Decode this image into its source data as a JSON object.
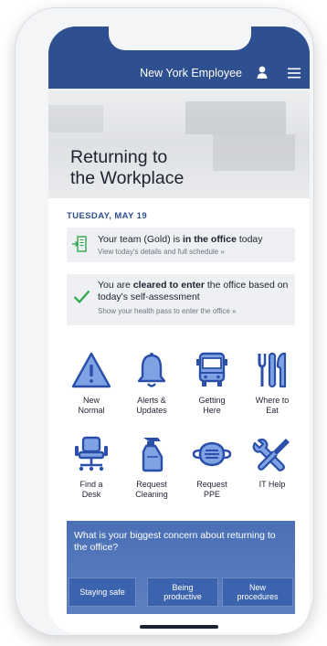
{
  "header": {
    "title": "New York Employee",
    "user_icon": "user-icon",
    "menu_icon": "menu-icon"
  },
  "hero": {
    "heading_line1": "Returning to",
    "heading_line2": "the Workplace"
  },
  "date": "TUESDAY, MAY 19",
  "cards": {
    "team": {
      "icon": "arrow-into-building-icon",
      "pre": "Your team (Gold) is ",
      "bold": "in the office",
      "post": " today",
      "link": "View today's details and full schedule »"
    },
    "health": {
      "icon": "checkmark-icon",
      "pre": "You are ",
      "bold": "cleared to enter",
      "post": " the office based on today's self-assessment",
      "link": "Show your health pass to enter the office »"
    }
  },
  "tiles": [
    {
      "label_1": "New",
      "label_2": "Normal",
      "icon": "warning-icon"
    },
    {
      "label_1": "Alerts &",
      "label_2": "Updates",
      "icon": "bell-icon"
    },
    {
      "label_1": "Getting",
      "label_2": "Here",
      "icon": "bus-icon"
    },
    {
      "label_1": "Where to",
      "label_2": "Eat",
      "icon": "utensils-icon"
    },
    {
      "label_1": "Find a",
      "label_2": "Desk",
      "icon": "office-chair-icon"
    },
    {
      "label_1": "Request",
      "label_2": "Cleaning",
      "icon": "spray-bottle-icon"
    },
    {
      "label_1": "Request",
      "label_2": "PPE",
      "icon": "face-mask-icon"
    },
    {
      "label_1": "IT Help",
      "label_2": "",
      "icon": "tools-icon"
    }
  ],
  "survey": {
    "question": "What is your biggest concern about returning to the office?",
    "options": [
      {
        "line1": "Staying safe",
        "line2": ""
      },
      {
        "line1": "Being",
        "line2": "productive"
      },
      {
        "line1": "New",
        "line2": "procedures"
      }
    ]
  },
  "colors": {
    "brand_navy": "#2e4f90",
    "icon_blue": "#2a4fa8",
    "icon_fill": "#7fa2e4",
    "check_green": "#2ea84a"
  }
}
